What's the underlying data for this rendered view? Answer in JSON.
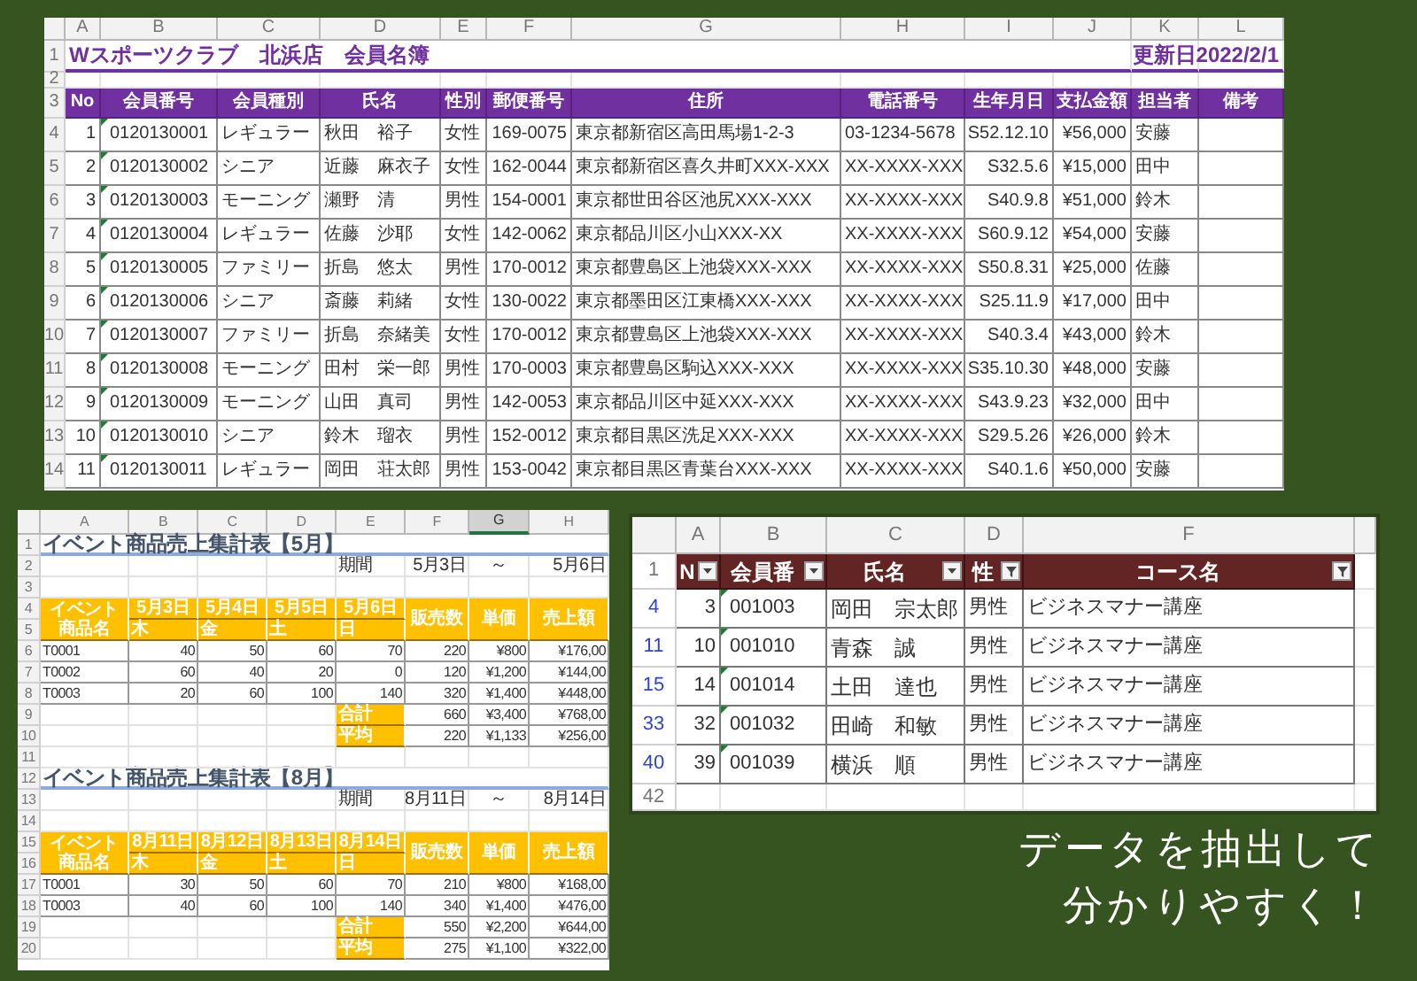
{
  "member_sheet": {
    "columns": [
      "A",
      "B",
      "C",
      "D",
      "E",
      "F",
      "G",
      "H",
      "I",
      "J",
      "K",
      "L"
    ],
    "row_numbers": [
      "1",
      "2",
      "3"
    ],
    "title": "Wスポーツクラブ　北浜店　会員名簿",
    "updated_label": "更新日",
    "updated_date": "2022/2/1",
    "headers": [
      "No",
      "会員番号",
      "会員種別",
      "氏名",
      "性別",
      "郵便番号",
      "住所",
      "電話番号",
      "生年月日",
      "支払金額",
      "担当者",
      "備考"
    ],
    "rows": [
      {
        "row_number": "4",
        "marked": true,
        "cells": [
          "1",
          "0120130001",
          "レギュラー",
          "秋田　裕子",
          "女性",
          "169-0075",
          "東京都新宿区高田馬場1-2-3",
          "03-1234-5678",
          "S52.12.10",
          "¥56,000",
          "安藤"
        ]
      },
      {
        "row_number": "5",
        "marked": true,
        "cells": [
          "2",
          "0120130002",
          "シニア",
          "近藤　麻衣子",
          "女性",
          "162-0044",
          "東京都新宿区喜久井町XXX-XXX",
          "XX-XXXX-XXX",
          "S32.5.6",
          "¥15,000",
          "田中"
        ]
      },
      {
        "row_number": "6",
        "marked": true,
        "cells": [
          "3",
          "0120130003",
          "モーニング",
          "瀬野　清",
          "男性",
          "154-0001",
          "東京都世田谷区池尻XXX-XXX",
          "XX-XXXX-XXX",
          "S40.9.8",
          "¥51,000",
          "鈴木"
        ]
      },
      {
        "row_number": "7",
        "marked": true,
        "cells": [
          "4",
          "0120130004",
          "レギュラー",
          "佐藤　沙耶",
          "女性",
          "142-0062",
          "東京都品川区小山XXX-XX",
          "XX-XXXX-XXX",
          "S60.9.12",
          "¥54,000",
          "安藤"
        ]
      },
      {
        "row_number": "8",
        "marked": true,
        "cells": [
          "5",
          "0120130005",
          "ファミリー",
          "折島　悠太",
          "男性",
          "170-0012",
          "東京都豊島区上池袋XXX-XXX",
          "XX-XXXX-XXX",
          "S50.8.31",
          "¥25,000",
          "佐藤"
        ]
      },
      {
        "row_number": "9",
        "marked": true,
        "cells": [
          "6",
          "0120130006",
          "シニア",
          "斎藤　莉緒",
          "女性",
          "130-0022",
          "東京都墨田区江東橋XXX-XXX",
          "XX-XXXX-XXX",
          "S25.11.9",
          "¥17,000",
          "田中"
        ]
      },
      {
        "row_number": "10",
        "marked": true,
        "cells": [
          "7",
          "0120130007",
          "ファミリー",
          "折島　奈緒美",
          "女性",
          "170-0012",
          "東京都豊島区上池袋XXX-XXX",
          "XX-XXXX-XXX",
          "S40.3.4",
          "¥43,000",
          "鈴木"
        ]
      },
      {
        "row_number": "11",
        "marked": true,
        "cells": [
          "8",
          "0120130008",
          "モーニング",
          "田村　栄一郎",
          "男性",
          "170-0003",
          "東京都豊島区駒込XXX-XXX",
          "XX-XXXX-XXX",
          "S35.10.30",
          "¥48,000",
          "安藤"
        ]
      },
      {
        "row_number": "12",
        "marked": true,
        "cells": [
          "9",
          "0120130009",
          "モーニング",
          "山田　真司",
          "男性",
          "142-0053",
          "東京都品川区中延XXX-XXX",
          "XX-XXXX-XXX",
          "S43.9.23",
          "¥32,000",
          "田中"
        ]
      },
      {
        "row_number": "13",
        "marked": true,
        "cells": [
          "10",
          "0120130010",
          "シニア",
          "鈴木　瑠衣",
          "男性",
          "152-0012",
          "東京都目黒区洗足XXX-XXX",
          "XX-XXXX-XXX",
          "S29.5.26",
          "¥26,000",
          "鈴木"
        ]
      },
      {
        "row_number": "14",
        "marked": true,
        "cells": [
          "11",
          "0120130011",
          "レギュラー",
          "岡田　荘太郎",
          "男性",
          "153-0042",
          "東京都目黒区青葉台XXX-XXX",
          "XX-XXXX-XXX",
          "S40.1.6",
          "¥50,000",
          "安藤"
        ]
      }
    ]
  },
  "sales_sheet": {
    "columns": [
      {
        "label": "A",
        "selected": false
      },
      {
        "label": "B",
        "selected": false
      },
      {
        "label": "C",
        "selected": false
      },
      {
        "label": "D",
        "selected": false
      },
      {
        "label": "E",
        "selected": false
      },
      {
        "label": "F",
        "selected": false
      },
      {
        "label": "G",
        "selected": true
      },
      {
        "label": "H",
        "selected": false
      }
    ],
    "row_numbers": [
      "1",
      "2",
      "3",
      "4",
      "5",
      "6",
      "7",
      "8",
      "9",
      "10",
      "11",
      "12",
      "13",
      "14",
      "15",
      "16",
      "17",
      "18",
      "19",
      "20"
    ],
    "tables": [
      {
        "title": "イベント商品売上集計表【5月】",
        "period_label": "期間",
        "period_start": "5月3日",
        "period_sep": "～",
        "period_end": "5月6日",
        "item_header": "イベント商品名",
        "dates": [
          "5月3日",
          "5月4日",
          "5月5日",
          "5月6日"
        ],
        "weekdays": [
          "木",
          "金",
          "土",
          "日"
        ],
        "headers": [
          "販売数",
          "単価",
          "売上額"
        ],
        "rows": [
          {
            "item": "T0001",
            "cells": [
              "40",
              "50",
              "60",
              "70",
              "220",
              "¥800",
              "¥176,00"
            ]
          },
          {
            "item": "T0002",
            "cells": [
              "60",
              "40",
              "20",
              "0",
              "120",
              "¥1,200",
              "¥144,00"
            ]
          },
          {
            "item": "T0003",
            "cells": [
              "20",
              "60",
              "100",
              "140",
              "320",
              "¥1,400",
              "¥448,00"
            ]
          }
        ],
        "summary": [
          {
            "label": "合計",
            "cells": [
              "660",
              "¥3,400",
              "¥768,00"
            ]
          },
          {
            "label": "平均",
            "cells": [
              "220",
              "¥1,133",
              "¥256,00"
            ]
          }
        ]
      },
      {
        "title": "イベント商品売上集計表【8月】",
        "period_label": "期間",
        "period_start": "8月11日",
        "period_sep": "～",
        "period_end": "8月14日",
        "item_header": "イベント商品名",
        "dates": [
          "8月11日",
          "8月12日",
          "8月13日",
          "8月14日"
        ],
        "weekdays": [
          "木",
          "金",
          "土",
          "日"
        ],
        "headers": [
          "販売数",
          "単価",
          "売上額"
        ],
        "rows": [
          {
            "item": "T0001",
            "cells": [
              "30",
              "50",
              "60",
              "70",
              "210",
              "¥800",
              "¥168,00"
            ]
          },
          {
            "item": "T0003",
            "cells": [
              "40",
              "60",
              "100",
              "140",
              "340",
              "¥1,400",
              "¥476,00"
            ]
          }
        ],
        "summary": [
          {
            "label": "合計",
            "cells": [
              "550",
              "¥2,200",
              "¥644,00"
            ]
          },
          {
            "label": "平均",
            "cells": [
              "275",
              "¥1,100",
              "¥322,00"
            ]
          }
        ]
      }
    ]
  },
  "filter_sheet": {
    "columns": [
      "A",
      "B",
      "C",
      "D",
      "F"
    ],
    "header_row_number": "1",
    "headers": [
      {
        "label": "N",
        "kind": "dropdown"
      },
      {
        "label": "会員番",
        "kind": "dropdown"
      },
      {
        "label": "氏名",
        "kind": "dropdown"
      },
      {
        "label": "性",
        "kind": "funnel"
      },
      {
        "label": "コース名",
        "kind": "funnel"
      }
    ],
    "rows": [
      {
        "row_number": "4",
        "filtered": true,
        "marked": true,
        "cells": [
          "3",
          "001003",
          "岡田　宗太郎",
          "男性",
          "ビジネスマナー講座"
        ]
      },
      {
        "row_number": "11",
        "filtered": true,
        "marked": true,
        "cells": [
          "10",
          "001010",
          "青森　誠",
          "男性",
          "ビジネスマナー講座"
        ]
      },
      {
        "row_number": "15",
        "filtered": true,
        "marked": true,
        "cells": [
          "14",
          "001014",
          "土田　達也",
          "男性",
          "ビジネスマナー講座"
        ]
      },
      {
        "row_number": "33",
        "filtered": true,
        "marked": true,
        "cells": [
          "32",
          "001032",
          "田崎　和敏",
          "男性",
          "ビジネスマナー講座"
        ]
      },
      {
        "row_number": "40",
        "filtered": true,
        "marked": true,
        "cells": [
          "39",
          "001039",
          "横浜　順",
          "男性",
          "ビジネスマナー講座"
        ]
      }
    ],
    "last_row_number": "42"
  },
  "caption": [
    "データを抽出して",
    "分かりやすく！"
  ]
}
